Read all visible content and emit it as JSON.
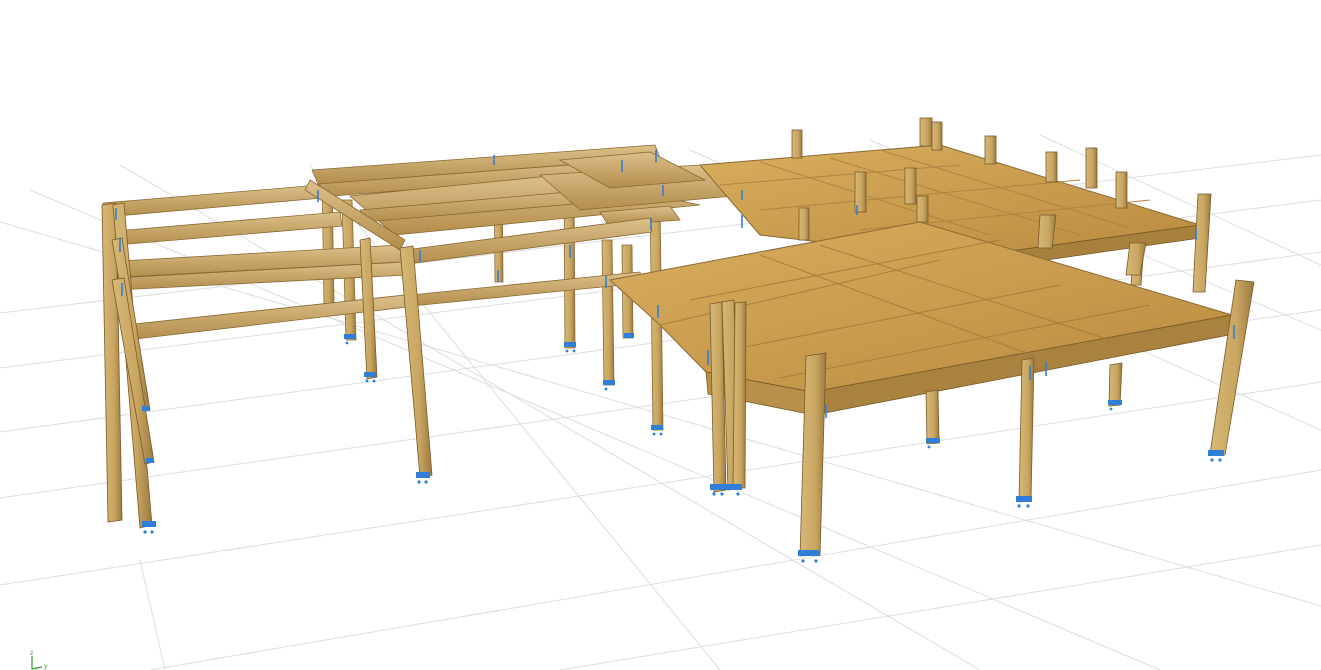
{
  "viewport": {
    "background": "#ffffff",
    "grid_color": "#d9d9d9",
    "wood_light": "#d9b66a",
    "wood_mid": "#c29a52",
    "wood_dark": "#8a6a35",
    "slab_color": "#c99a4a",
    "support_color": "#2f7fd8"
  },
  "triad": {
    "y_axis": "y",
    "z_axis": "z"
  }
}
